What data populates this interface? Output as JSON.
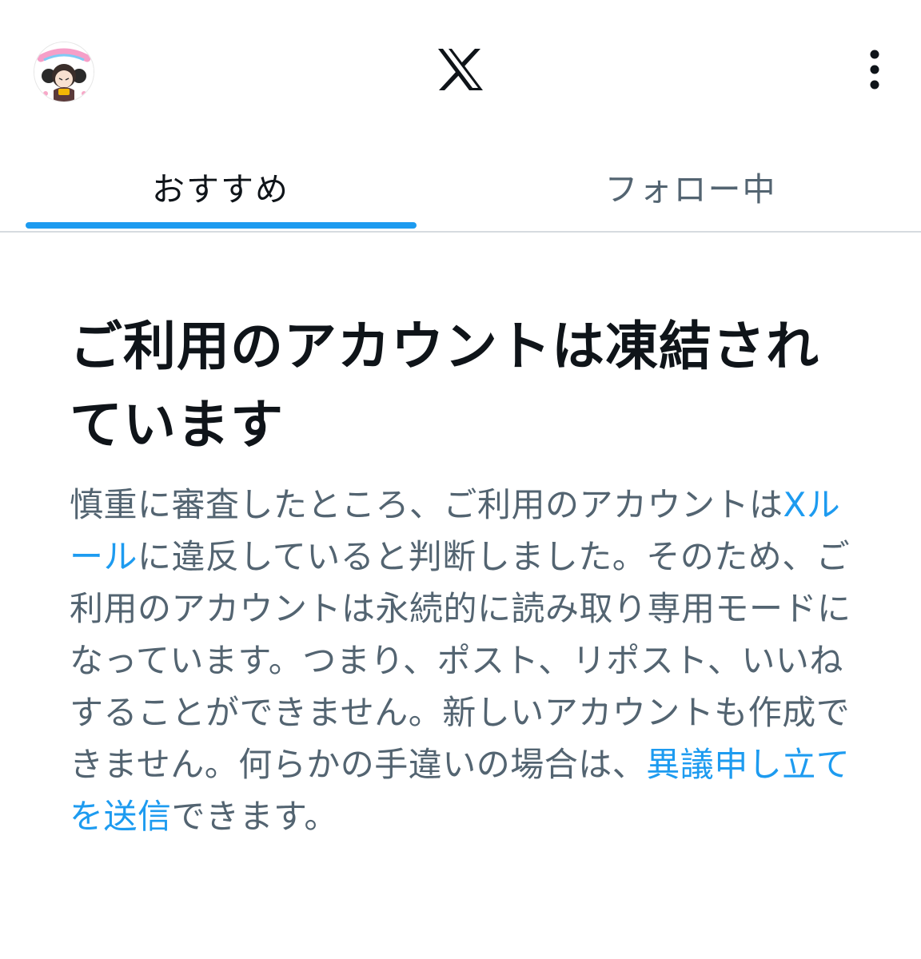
{
  "header": {
    "avatar_alt": "profile avatar",
    "logo_icon": "x-logo-icon",
    "menu_icon": "more-vertical-icon"
  },
  "tabs": [
    {
      "label": "おすすめ",
      "active": true
    },
    {
      "label": "フォロー中",
      "active": false
    }
  ],
  "colors": {
    "accent": "#1d9bf0",
    "text_primary": "#0f1419",
    "text_secondary": "#536471",
    "divider": "#d6dbdf"
  },
  "notice": {
    "title": "ご利用のアカウントは凍結されています",
    "body_part1": "慎重に審査したところ、ご利用のアカウントは",
    "rules_link": "Xルール",
    "body_part2": "に違反していると判断しました。そのため、ご利用のアカウントは永続的に読み取り専用モードになっています。つまり、ポスト、リポスト、いいねすることができません。新しいアカウントも作成できません。何らかの手違いの場合は、",
    "appeal_link": "異議申し立てを送信",
    "body_part3": "できます。"
  }
}
